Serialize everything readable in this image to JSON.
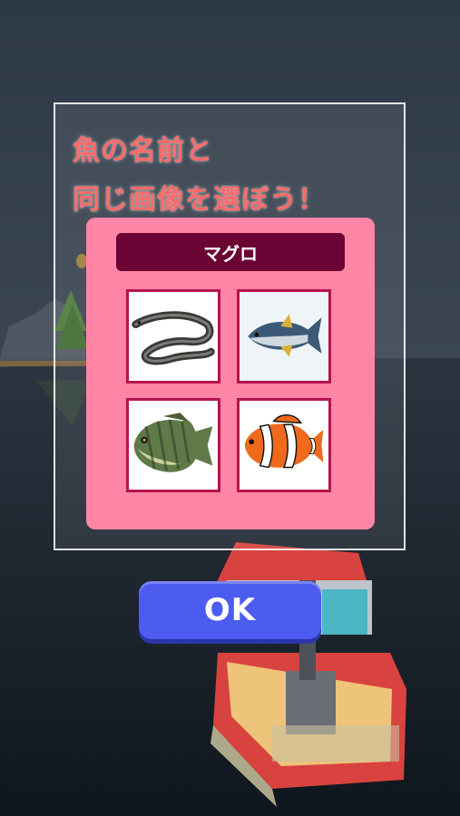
{
  "instruction": {
    "line1": "魚の名前と",
    "line2": "同じ画像を選ぼう！"
  },
  "quiz": {
    "fish_name": "マグロ",
    "choices": [
      {
        "icon": "eel-image"
      },
      {
        "icon": "tuna-image"
      },
      {
        "icon": "bluegill-image"
      },
      {
        "icon": "clownfish-image"
      }
    ]
  },
  "ok_button": {
    "label": "OK"
  },
  "colors": {
    "instruction_text": "#ff6a6a",
    "panel": "#ff85a6",
    "name_bar": "#6b0335",
    "choice_border": "#b5134d",
    "ok_button": "#4c5cf0"
  }
}
